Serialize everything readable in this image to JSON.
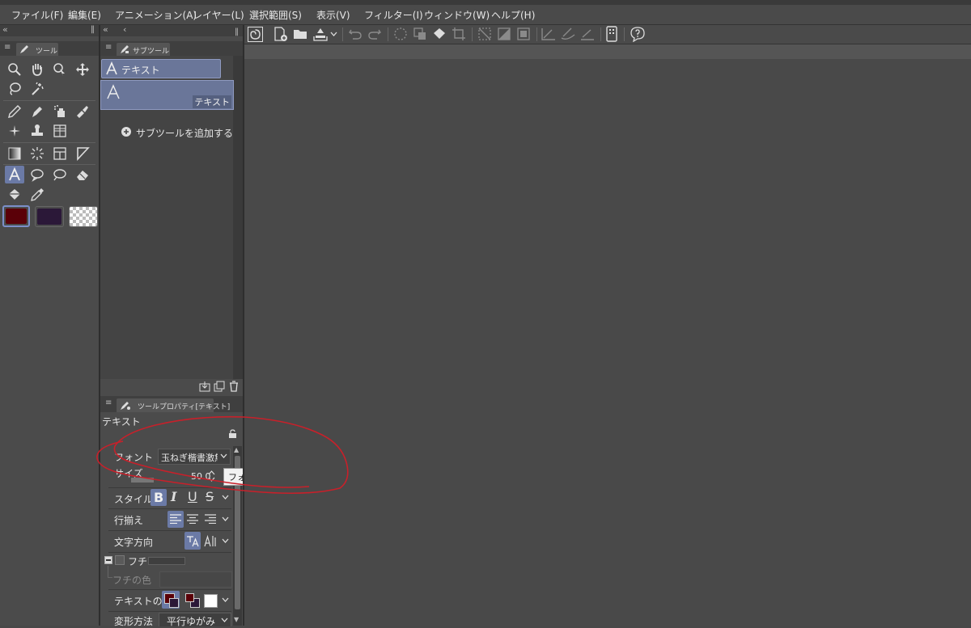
{
  "menu": [
    "ファイル(F)",
    "編集(E)",
    "アニメーション(A)",
    "レイヤー(L)",
    "選択範囲(S)",
    "表示(V)",
    "フィルター(I)",
    "ウィンドウ(W)",
    "ヘルプ(H)"
  ],
  "tool_panel": {
    "tab": "ツール"
  },
  "subtool_panel": {
    "tab": "サブツール",
    "group_label": "テキスト",
    "item_label": "テキスト",
    "add_label": "サブツールを追加する"
  },
  "properties": {
    "tab": "ツールプロパティ[テキスト]",
    "title": "テキスト",
    "font_label": "フォント",
    "font_value": "玉ねぎ楷書激無料",
    "size_label": "サイズ",
    "size_value": "50.0",
    "tooltip": "フォントを選択します",
    "style_label": "スタイル",
    "align_label": "行揃え",
    "direction_label": "文字方向",
    "edge_label": "フチ",
    "edge_color_label": "フチの色",
    "text_color_label": "テキストの色",
    "transform_label": "変形方法",
    "transform_value": "平行ゆがみ",
    "bold": "B",
    "italic": "I",
    "underline": "U",
    "strike": "S"
  },
  "colors": {
    "main_color": "#5a0008",
    "sub_color": "#2b1838",
    "accent": "#6b7aa6",
    "annotation": "#c8202a"
  }
}
